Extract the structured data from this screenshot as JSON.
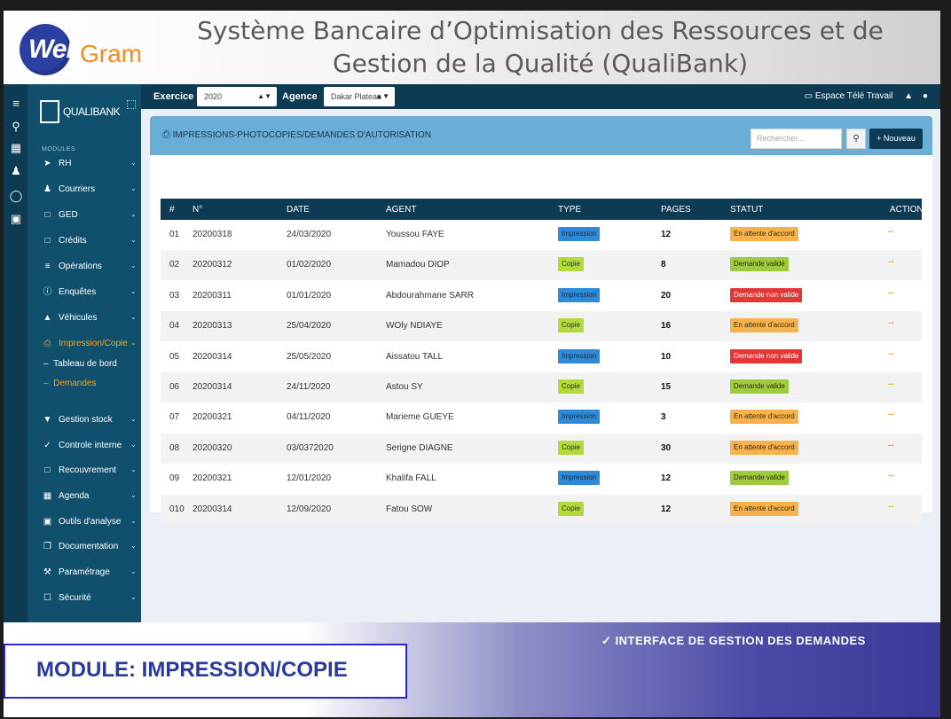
{
  "banner": {
    "logo_web": "Web",
    "logo_gram": "Gram",
    "title_line1": "Système Bancaire d’Optimisation des Ressources et de",
    "title_line2": "Gestion de la Qualité (QualiBank)"
  },
  "sidebar": {
    "brand": "QUALIBANK",
    "modules_label": "MODULES",
    "items": [
      {
        "label": "RH",
        "icon": "rocket-icon"
      },
      {
        "label": "Courriers",
        "icon": "users-icon"
      },
      {
        "label": "GED",
        "icon": "folder-icon"
      },
      {
        "label": "Crédits",
        "icon": "folder-icon"
      },
      {
        "label": "Opérations",
        "icon": "list-icon"
      },
      {
        "label": "Enquêtes",
        "icon": "question-icon"
      },
      {
        "label": "Véhicules",
        "icon": "car-icon"
      },
      {
        "label": "Impression/Copie",
        "icon": "printer-icon",
        "active": true
      },
      {
        "label": "Gestion stock",
        "icon": "cart-icon"
      },
      {
        "label": "Controle interne",
        "icon": "check-circle-icon"
      },
      {
        "label": "Recouvrement",
        "icon": "folder-icon"
      },
      {
        "label": "Agenda",
        "icon": "calendar-icon"
      },
      {
        "label": "Outils d'analyse",
        "icon": "database-icon"
      },
      {
        "label": "Documentation",
        "icon": "copy-icon"
      },
      {
        "label": "Paramétrage",
        "icon": "wrench-icon"
      },
      {
        "label": "Sécurité",
        "icon": "lock-icon"
      }
    ],
    "sub_items": [
      {
        "label": "Tableau de bord"
      },
      {
        "label": "Demandes",
        "active": true
      }
    ]
  },
  "topbar": {
    "exercice_label": "Exercice",
    "exercice_value": "2020",
    "agence_label": "Agence",
    "agence_value": "Dakar Plateau",
    "espace": "Espace Télé Travail"
  },
  "card": {
    "title": "IMPRESSIONS-PHOTOCOPIES/DEMANDES D'AUTORISATION",
    "search_placeholder": "Rechercher...",
    "new_button": "+ Nouveau"
  },
  "table": {
    "headers": [
      "#",
      "N°",
      "DATE",
      "AGENT",
      "TYPE",
      "PAGES",
      "STATUT",
      "ACTION"
    ],
    "rows": [
      {
        "idx": "01",
        "num": "20200318",
        "date": "24/03/2020",
        "agent": "Youssou FAYE",
        "type": "Impression",
        "pages": "12",
        "statut": "En attente d'accord"
      },
      {
        "idx": "02",
        "num": "20200312",
        "date": "01/02/2020",
        "agent": "Mamadou DIOP",
        "type": "Copie",
        "pages": "8",
        "statut": "Demande validé"
      },
      {
        "idx": "03",
        "num": "20200311",
        "date": "01/01/2020",
        "agent": "Abdourahmane SARR",
        "type": "Impression",
        "pages": "20",
        "statut": "Demande non valide"
      },
      {
        "idx": "04",
        "num": "20200313",
        "date": "25/04/2020",
        "agent": "WOly NDIAYE",
        "type": "Copie",
        "pages": "16",
        "statut": "En attente d'accord"
      },
      {
        "idx": "05",
        "num": "20200314",
        "date": "25/05/2020",
        "agent": "Aissatou TALL",
        "type": "Impression",
        "pages": "10",
        "statut": "Demande non valide"
      },
      {
        "idx": "06",
        "num": "20200314",
        "date": "24/11/2020",
        "agent": "Astou SY",
        "type": "Copie",
        "pages": "15",
        "statut": "Demande valide"
      },
      {
        "idx": "07",
        "num": "20200321",
        "date": "04/11/2020",
        "agent": "Marieme GUEYE",
        "type": "Impression",
        "pages": "3",
        "statut": "En attente d'accord"
      },
      {
        "idx": "08",
        "num": "20200320",
        "date": "03/0372020",
        "agent": "Serigne DIAGNE",
        "type": "Copie",
        "pages": "30",
        "statut": "En attente d'accord"
      },
      {
        "idx": "09",
        "num": "20200321",
        "date": "12/01/2020",
        "agent": "Khalifa FALL",
        "type": "Impression",
        "pages": "12",
        "statut": "Demande valide"
      },
      {
        "idx": "010",
        "num": "20200314",
        "date": "12/09/2020",
        "agent": "Fatou SOW",
        "type": "Copie",
        "pages": "12",
        "statut": "En attente d'accord"
      }
    ],
    "action_glyph": "--"
  },
  "colors": {
    "impression": "#2e8ad8",
    "copie": "#b3d93a",
    "attente": "#f7b24a",
    "valide": "#9ccc3d",
    "non_valide": "#e63535"
  },
  "footer": {
    "module": "MODULE: IMPRESSION/COPIE",
    "interface": "✓  INTERFACE  DE  GESTION  DES  DEMANDES"
  }
}
